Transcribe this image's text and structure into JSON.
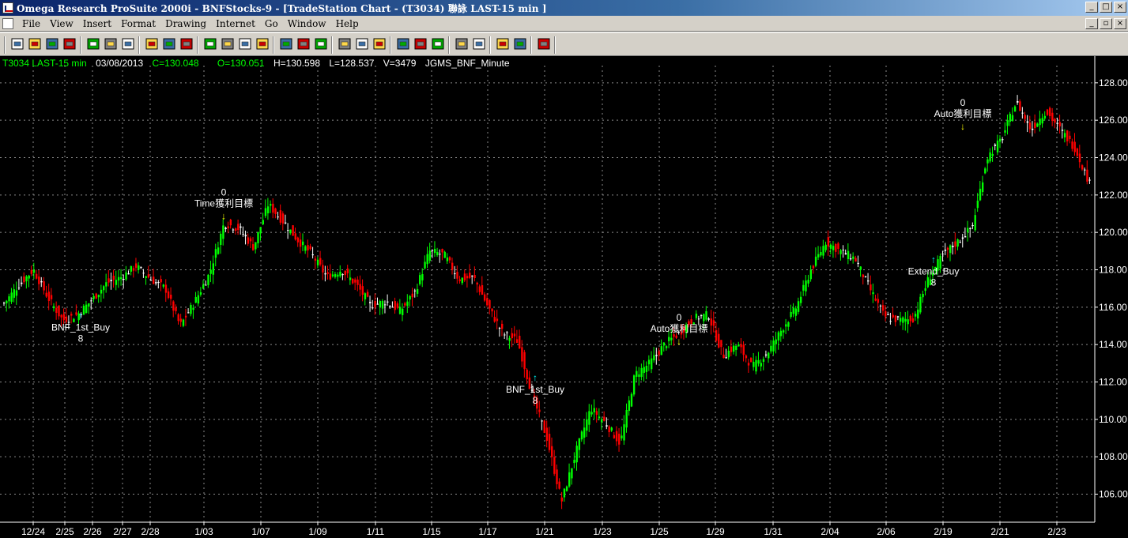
{
  "window": {
    "title": "Omega Research ProSuite 2000i - BNFStocks-9 - [TradeStation Chart - (T3034) 聯詠 LAST-15 min ]"
  },
  "menubar": [
    "File",
    "View",
    "Insert",
    "Format",
    "Drawing",
    "Internet",
    "Go",
    "Window",
    "Help"
  ],
  "toolbar": {
    "icons": [
      "new-document-icon",
      "open-folder-icon",
      "save-icon",
      "open-workspace-icon",
      "print-icon",
      "print-preview-icon",
      "format-analysis-icon",
      "format-window-icon",
      "insert-indicator-icon",
      "scroll-left-icon",
      "scroll-right-icon",
      "scroll-end-icon",
      "expand-chart-icon",
      "compress-chart-icon",
      "data-window-icon",
      "bar-chart-icon",
      "table-icon",
      "grid-icon",
      "drawing-tool-icon",
      "trendline-icon",
      "cross-hair-icon",
      "time-shift-icon",
      "zoom-in-icon",
      "zoom-out-icon",
      "tools-icon",
      "pointer-icon",
      "global-icon",
      "cursor-icon"
    ]
  },
  "status": {
    "symbol": "T3034 LAST-15 min",
    "date": "03/08/2013",
    "close": "C=130.048",
    "open": "O=130.051",
    "high": "H=130.598",
    "low": "L=128.537",
    "volume": "V=3479",
    "strategy": "JGMS_BNF_Minute",
    "colors": {
      "symbol": "#00ff00",
      "date": "#ffffff",
      "close": "#00ff00",
      "open": "#00ff00",
      "high": "#ffffff",
      "low": "#ffffff",
      "volume": "#ffffff",
      "strategy": "#ffffff"
    }
  },
  "chart_data": {
    "type": "bar",
    "style": "colored OHLC bars",
    "y_axis": {
      "ticks": [
        "128.00",
        "126.00",
        "124.00",
        "122.00",
        "120.00",
        "118.00",
        "116.00",
        "114.00",
        "112.00",
        "110.00",
        "108.00",
        "106.00"
      ],
      "range": [
        104.5,
        128.5
      ]
    },
    "x_axis": {
      "ticks": [
        "12/24",
        "2/25",
        "2/26",
        "2/27",
        "2/28",
        "1/03",
        "1/07",
        "1/09",
        "1/11",
        "1/15",
        "1/17",
        "1/21",
        "1/23",
        "1/25",
        "1/29",
        "1/31",
        "2/04",
        "2/06",
        "2/19",
        "2/21",
        "2/23"
      ]
    },
    "grid": true,
    "up_color": "#00ff00",
    "down_color": "#ff0000",
    "price_path": [
      116.2,
      117.2,
      118.0,
      116.5,
      115.3,
      115.6,
      116.4,
      117.3,
      117.6,
      118.2,
      117.5,
      117.0,
      115.0,
      116.3,
      117.8,
      120.5,
      120.2,
      119.2,
      121.5,
      120.6,
      119.6,
      118.8,
      117.6,
      118.0,
      117.2,
      116.1,
      116.3,
      115.8,
      116.8,
      119.0,
      118.8,
      117.5,
      117.6,
      116.0,
      114.6,
      114.2,
      111.3,
      109.0,
      105.6,
      108.3,
      110.6,
      109.8,
      108.7,
      112.4,
      113.0,
      114.0,
      114.6,
      115.4,
      115.6,
      113.4,
      114.0,
      112.8,
      113.5,
      114.8,
      116.0,
      118.0,
      119.5,
      119.0,
      118.6,
      117.0,
      115.5,
      115.3,
      115.4,
      117.5,
      118.8,
      119.5,
      120.3,
      124.0,
      125.0,
      127.0,
      125.5,
      126.5,
      125.5,
      124.5,
      122.6
    ],
    "data_labels": [
      {
        "text": "BNF_1st_Buy",
        "sub": "8",
        "date": "12/24",
        "price": 115.5,
        "signal": "buy"
      },
      {
        "text": "Time獲利目標",
        "top": "0",
        "date": "1/03",
        "price": 120.7,
        "signal": "exit"
      },
      {
        "text": "BNF_1st_Buy",
        "sub": "8",
        "date": "1/17",
        "price": 112.2,
        "signal": "buy"
      },
      {
        "text": "Auto獲利目標",
        "top": "0",
        "date": "1/25",
        "price": 114.0,
        "signal": "exit"
      },
      {
        "text": "Extend_Buy",
        "sub": "8",
        "date": "2/06",
        "price": 118.5,
        "signal": "buy"
      },
      {
        "text": "Auto獲利目標",
        "top": "0",
        "date": "2/19",
        "price": 125.5,
        "signal": "exit"
      }
    ]
  }
}
